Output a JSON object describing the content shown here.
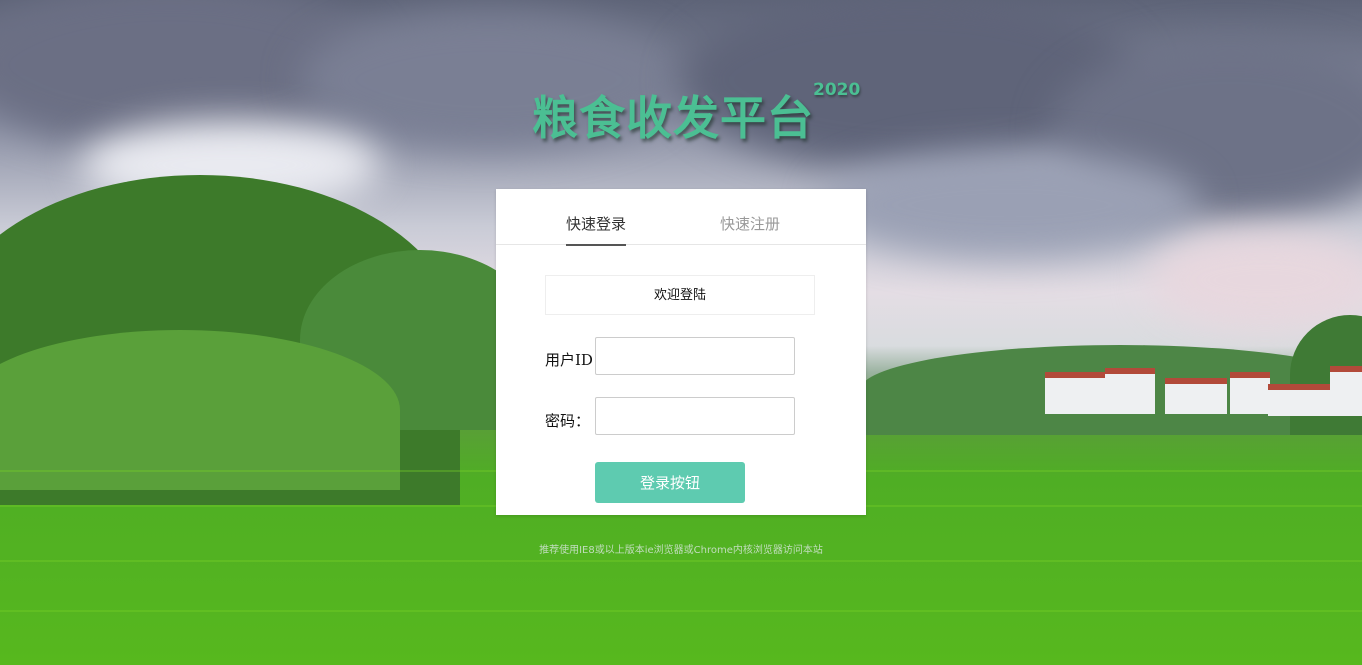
{
  "header": {
    "title": "粮食收发平台",
    "year": "2020"
  },
  "tabs": {
    "login": "快速登录",
    "register": "快速注册"
  },
  "form": {
    "welcome": "欢迎登陆",
    "user_id_label": "用户ID",
    "user_id_value": "",
    "password_label": "密码：",
    "password_value": "",
    "submit_label": "登录按钮"
  },
  "footer": {
    "tip": "推荐使用IE8或以上版本ie浏览器或Chrome内核浏览器访问本站"
  },
  "colors": {
    "accent": "#5ecbb0",
    "title": "#4bbf93"
  }
}
